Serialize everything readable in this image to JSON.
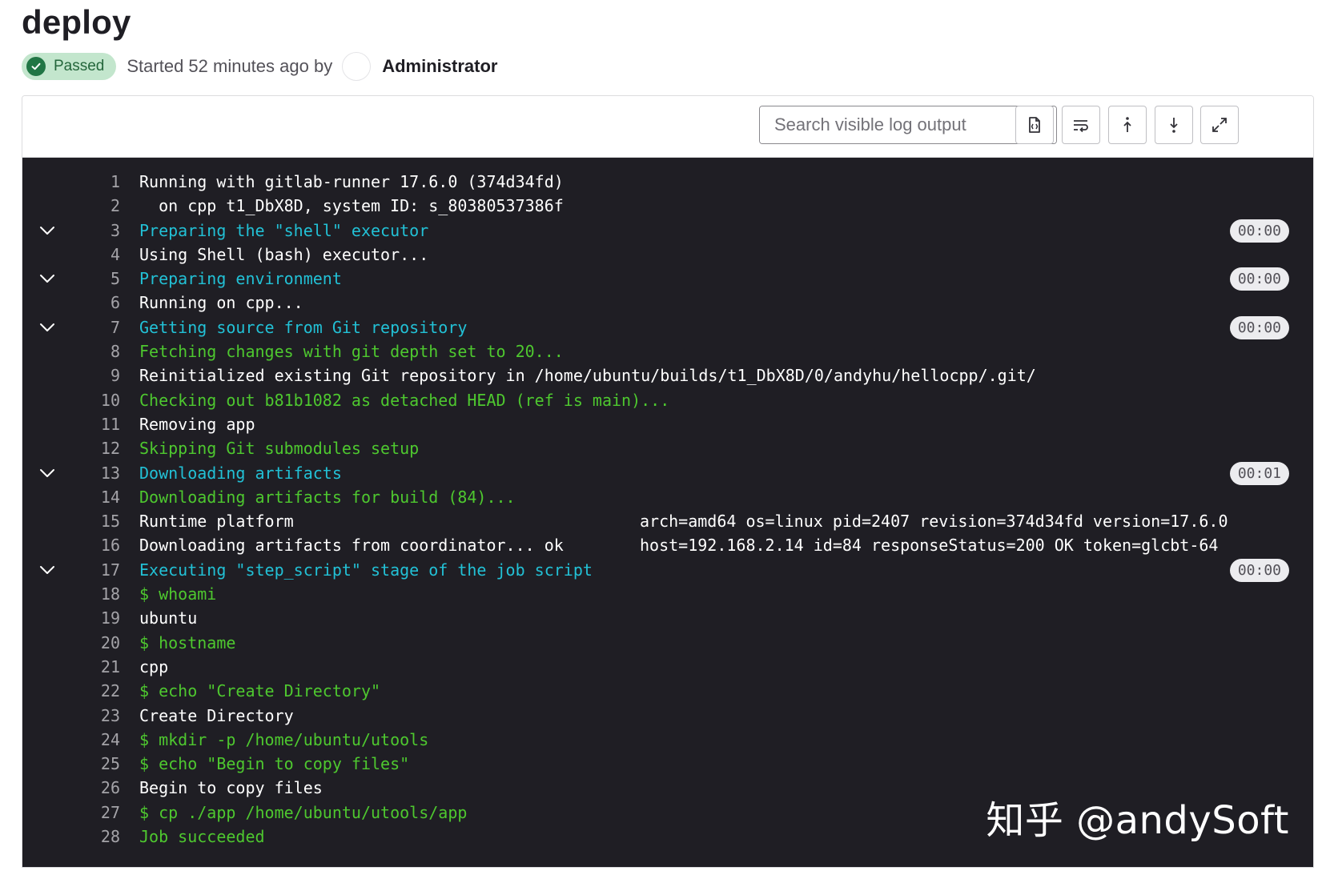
{
  "job": {
    "title": "deploy",
    "status": "Passed",
    "started_text": "Started 52 minutes ago by",
    "author": "Administrator"
  },
  "toolbar": {
    "search_placeholder": "Search visible log output",
    "buttons": [
      "search-icon",
      "raw-log-icon",
      "wrap-lines-icon",
      "scroll-top-icon",
      "scroll-bottom-icon",
      "fullscreen-icon"
    ]
  },
  "colors": {
    "section": "#22c1d6",
    "green": "#4ec82f",
    "log_bg": "#1f1e24",
    "status_bg": "#c3e6cd",
    "status_fg": "#24663b"
  },
  "log": {
    "lines": [
      {
        "num": "1",
        "text": "Running with gitlab-runner 17.6.0 (374d34fd)",
        "style": "white"
      },
      {
        "num": "2",
        "text": "  on cpp t1_DbX8D, system ID: s_80380537386f",
        "style": "white"
      },
      {
        "num": "3",
        "text": "Preparing the \"shell\" executor",
        "style": "section",
        "collapsible": true,
        "duration": "00:00"
      },
      {
        "num": "4",
        "text": "Using Shell (bash) executor...",
        "style": "white"
      },
      {
        "num": "5",
        "text": "Preparing environment",
        "style": "section",
        "collapsible": true,
        "duration": "00:00"
      },
      {
        "num": "6",
        "text": "Running on cpp...",
        "style": "white"
      },
      {
        "num": "7",
        "text": "Getting source from Git repository",
        "style": "section",
        "collapsible": true,
        "duration": "00:00"
      },
      {
        "num": "8",
        "text": "Fetching changes with git depth set to 20...",
        "style": "green"
      },
      {
        "num": "9",
        "text": "Reinitialized existing Git repository in /home/ubuntu/builds/t1_DbX8D/0/andyhu/hellocpp/.git/",
        "style": "white"
      },
      {
        "num": "10",
        "text": "Checking out b81b1082 as detached HEAD (ref is main)...",
        "style": "green"
      },
      {
        "num": "11",
        "text": "Removing app",
        "style": "white"
      },
      {
        "num": "12",
        "text": "Skipping Git submodules setup",
        "style": "green"
      },
      {
        "num": "13",
        "text": "Downloading artifacts",
        "style": "section",
        "collapsible": true,
        "duration": "00:01"
      },
      {
        "num": "14",
        "text": "Downloading artifacts for build (84)...",
        "style": "green"
      },
      {
        "num": "15",
        "text": "Runtime platform",
        "text2": "arch=amd64 os=linux pid=2407 revision=374d34fd version=17.6.0",
        "style": "white"
      },
      {
        "num": "16",
        "text": "Downloading artifacts from coordinator... ok",
        "text2": "host=192.168.2.14 id=84 responseStatus=200 OK token=glcbt-64",
        "style": "white"
      },
      {
        "num": "17",
        "text": "Executing \"step_script\" stage of the job script",
        "style": "section",
        "collapsible": true,
        "duration": "00:00"
      },
      {
        "num": "18",
        "text": "$ whoami",
        "style": "green"
      },
      {
        "num": "19",
        "text": "ubuntu",
        "style": "white"
      },
      {
        "num": "20",
        "text": "$ hostname",
        "style": "green"
      },
      {
        "num": "21",
        "text": "cpp",
        "style": "white"
      },
      {
        "num": "22",
        "text": "$ echo \"Create Directory\"",
        "style": "green"
      },
      {
        "num": "23",
        "text": "Create Directory",
        "style": "white"
      },
      {
        "num": "24",
        "text": "$ mkdir -p /home/ubuntu/utools",
        "style": "green"
      },
      {
        "num": "25",
        "text": "$ echo \"Begin to copy files\"",
        "style": "green"
      },
      {
        "num": "26",
        "text": "Begin to copy files",
        "style": "white"
      },
      {
        "num": "27",
        "text": "$ cp ./app /home/ubuntu/utools/app",
        "style": "green"
      },
      {
        "num": "28",
        "text": "Job succeeded",
        "style": "green"
      }
    ]
  },
  "watermark": "知乎 @andySoft"
}
